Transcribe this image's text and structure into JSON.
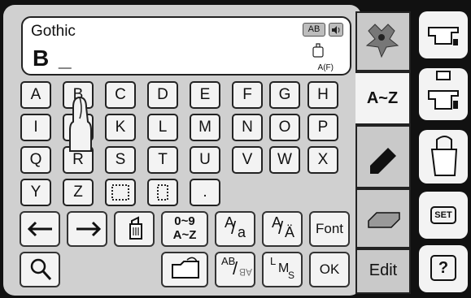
{
  "display": {
    "font_name": "Gothic",
    "typed_text": "B _",
    "badge": "AB",
    "ref_label": "A(F)"
  },
  "keyboard": {
    "rows": [
      [
        "A",
        "B",
        "C",
        "D",
        "E",
        "F",
        "G",
        "H"
      ],
      [
        "I",
        "",
        "K",
        "L",
        "M",
        "N",
        "O",
        "P"
      ],
      [
        "Q",
        "R",
        "S",
        "T",
        "U",
        "V",
        "W",
        "X"
      ],
      [
        "Y",
        "Z",
        "",
        "",
        "."
      ]
    ],
    "icons": [
      "hand-pointer-icon",
      "dotted-space-wide-icon",
      "dotted-space-narrow-icon"
    ]
  },
  "bottom_row1": {
    "num_label_top": "0~9",
    "num_label_bottom": "A~Z",
    "case_small_a": "a",
    "case_big_a": "A",
    "umlaut_a": "A",
    "umlaut_mark": "Ä",
    "font": "Font"
  },
  "bottom_row2": {
    "ab_flip_top": "AB",
    "ab_flip_bottom": "AB",
    "lms_l": "L",
    "lms_m": "M",
    "lms_s": "S",
    "ok": "OK"
  },
  "right_tabs": {
    "az": "A~Z",
    "edit": "Edit"
  },
  "side": {
    "set": "SET",
    "help": "?"
  }
}
